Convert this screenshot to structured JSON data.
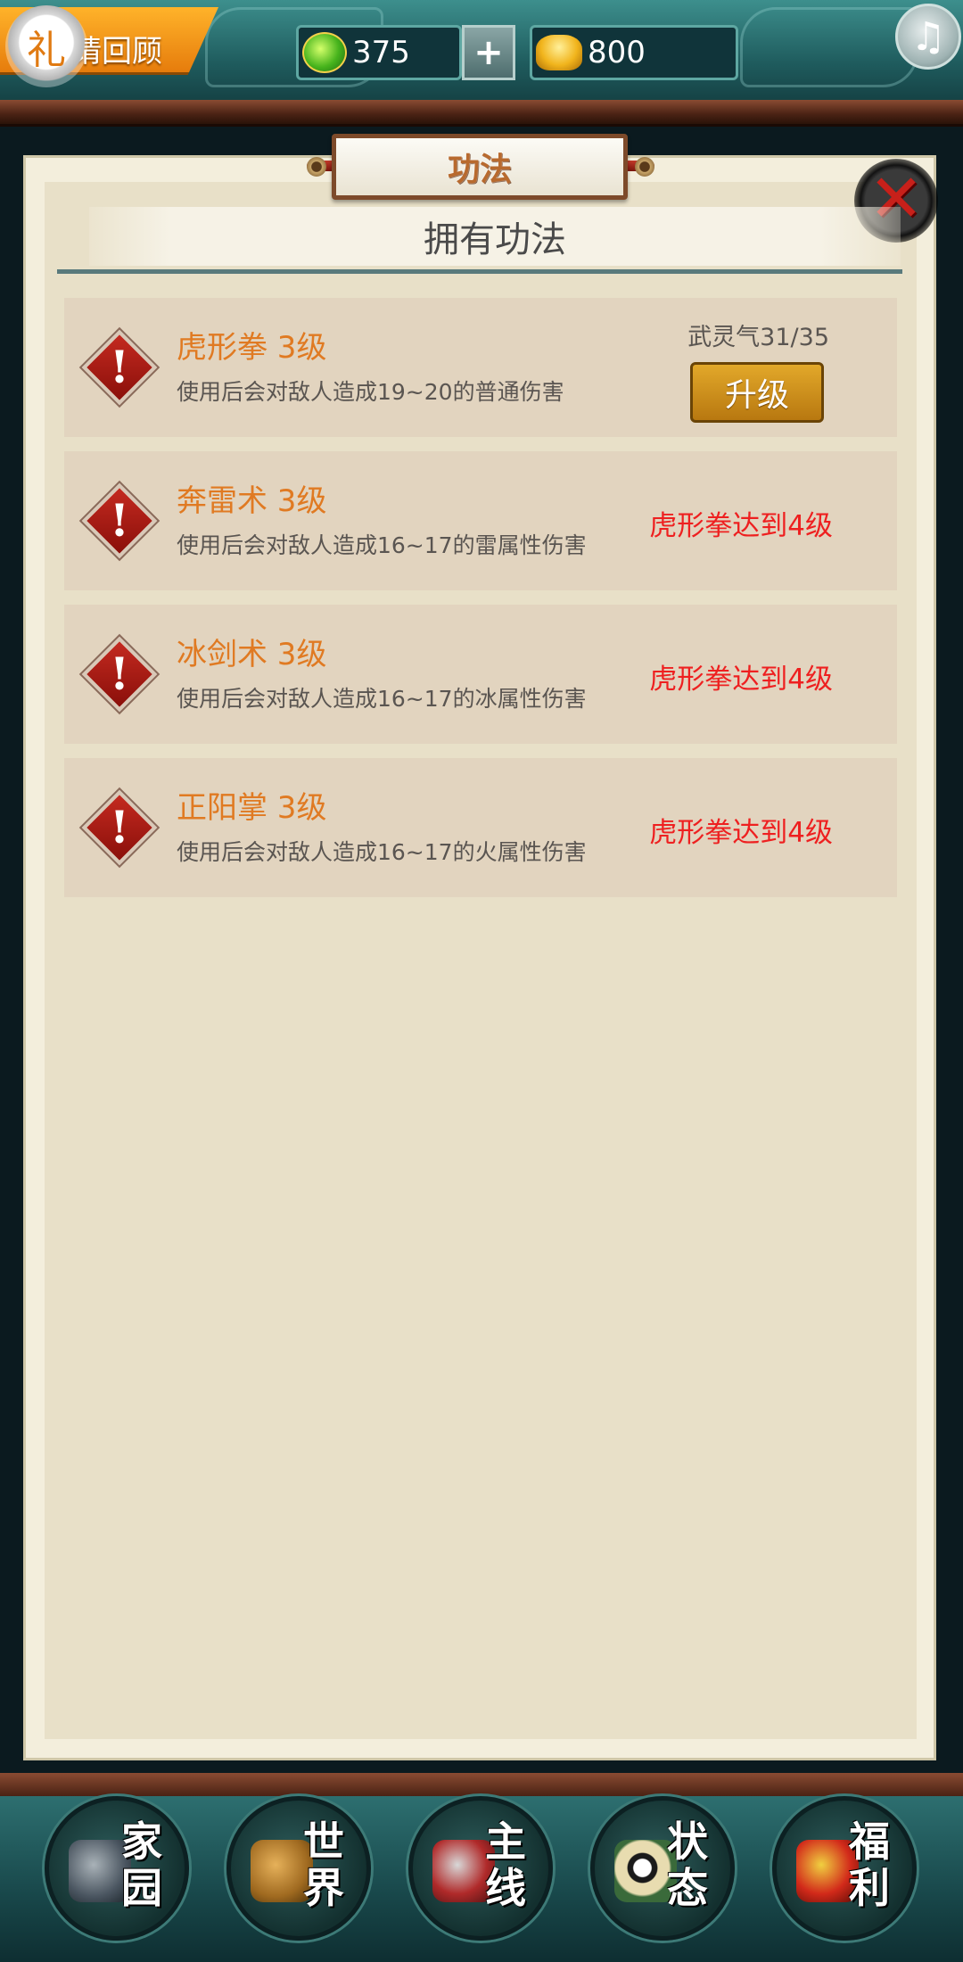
{
  "topbar": {
    "banner_text": "请回顾",
    "gift_icon_text": "礼",
    "jade_count": "375",
    "plus_label": "+",
    "gold_count": "800",
    "music_glyph": "♫"
  },
  "panel": {
    "title": "功法",
    "section_header": "拥有功法",
    "close_glyph": "✕"
  },
  "skills": [
    {
      "name": "虎形拳 3级",
      "desc": "使用后会对敌人造成19~20的普通伤害",
      "energy": "武灵气31/35",
      "action": "升级"
    },
    {
      "name": "奔雷术 3级",
      "desc": "使用后会对敌人造成16~17的雷属性伤害",
      "requirement": "虎形拳达到4级"
    },
    {
      "name": "冰剑术 3级",
      "desc": "使用后会对敌人造成16~17的冰属性伤害",
      "requirement": "虎形拳达到4级"
    },
    {
      "name": "正阳掌 3级",
      "desc": "使用后会对敌人造成16~17的火属性伤害",
      "requirement": "虎形拳达到4级"
    }
  ],
  "skill_icon_glyph": "!",
  "nav": [
    {
      "top": "家",
      "bottom": "园",
      "icon": "home-icon"
    },
    {
      "top": "世",
      "bottom": "界",
      "icon": "world-icon"
    },
    {
      "top": "主",
      "bottom": "线",
      "icon": "main-quest-icon"
    },
    {
      "top": "状",
      "bottom": "态",
      "icon": "status-icon"
    },
    {
      "top": "福",
      "bottom": "利",
      "icon": "welfare-icon"
    }
  ],
  "colors": {
    "skill_name": "#e07a22",
    "requirement": "#ee2020",
    "panel_bg": "#e8e0c8",
    "row_bg": "#e2d4bf",
    "upgrade_button": "#c8891a"
  }
}
